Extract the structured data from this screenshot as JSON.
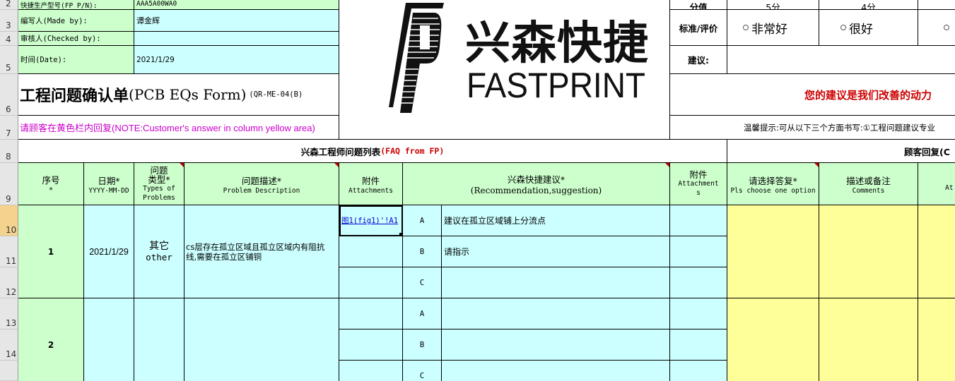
{
  "rows": [
    "2",
    "3",
    "4",
    "5",
    "6",
    "7",
    "8",
    "9",
    "10",
    "11",
    "12",
    "13",
    "14"
  ],
  "info": {
    "pn_label": "快捷生产型号(FP P/N):",
    "pn_value": "AAA5A00WA0",
    "made_label": "编写人(Made by):",
    "made_value": "谭金辉",
    "checked_label": "审核人(Checked by):",
    "date_label": "时间(Date):",
    "date_value": "2021/1/29"
  },
  "form": {
    "title_cn": "工程问题确认单",
    "title_en": "(PCB EQs Form)",
    "code": "(QR-ME-04(B)",
    "note": "请顾客在黄色栏内回复(NOTE:Customer's answer in column yellow area)"
  },
  "logo": {
    "cn": "兴森快捷",
    "en": "FASTPRINT"
  },
  "rating": {
    "score_label": "分值",
    "score_5": "5分",
    "score_4": "4分",
    "std_label": "标准/评价",
    "opt_5": "非常好",
    "opt_4": "很好",
    "advice_label": "建议:",
    "slogan": "您的建议是我们改善的动力",
    "tip": "温馨提示:可从以下三个方面书写:①工程问题建议专业"
  },
  "section": {
    "fp_title": "兴森工程师问题列表",
    "fp_tag": "(FAQ from FP)",
    "customer_title": "顾客回复(C"
  },
  "headers": {
    "no_cn": "序号",
    "no_en": "*",
    "date_cn": "日期*",
    "date_en": "YYYY-MM-DD",
    "type_cn1": "问题",
    "type_cn2": "类型*",
    "type_en1": "Types of",
    "type_en2": "Problems",
    "desc_cn": "问题描述*",
    "desc_en": "Problem Description",
    "att_cn": "附件",
    "att_en": "Attachments",
    "rec_cn": "兴森快捷建议*",
    "rec_en": "(Recommendation,suggestion)",
    "att2_cn": "附件",
    "att2_en1": "Attachment",
    "att2_en2": "s",
    "choose_cn": "请选择答复*",
    "choose_en": "Pls choose one option",
    "comm_cn": "描述或备注",
    "comm_en": "Comments",
    "att3_en": "At"
  },
  "items": [
    {
      "no": "1",
      "date": "2021/1/29",
      "type_cn": "其它",
      "type_en": "other",
      "desc_line1": "cs层存在孤立区域且孤立区域内有阻抗",
      "desc_line2": "线,需要在孤立区铺铜",
      "attachment": "图1(fig1)'!A1",
      "options": [
        {
          "letter": "A",
          "text": "建议在孤立区域铺上分流点"
        },
        {
          "letter": "B",
          "text": "请指示"
        },
        {
          "letter": "C",
          "text": ""
        }
      ]
    },
    {
      "no": "2",
      "date": "",
      "type_cn": "",
      "type_en": "",
      "desc_line1": "",
      "desc_line2": "",
      "attachment": "",
      "options": [
        {
          "letter": "A",
          "text": ""
        },
        {
          "letter": "B",
          "text": ""
        },
        {
          "letter": "C",
          "text": ""
        }
      ]
    }
  ]
}
